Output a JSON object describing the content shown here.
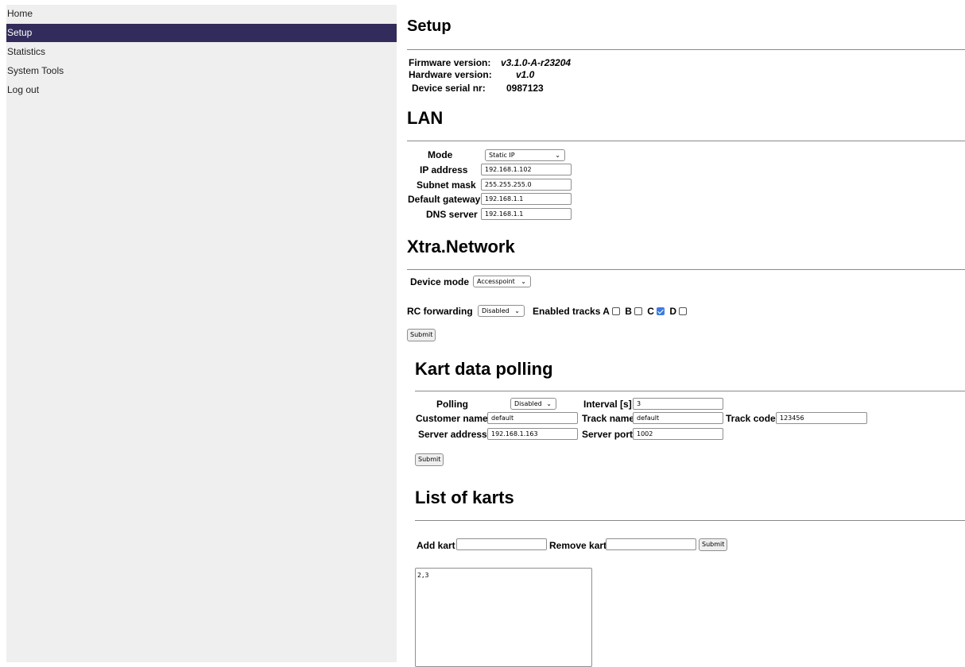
{
  "sidebar": {
    "items": [
      {
        "label": "Home"
      },
      {
        "label": "Setup",
        "active": true
      },
      {
        "label": "Statistics"
      },
      {
        "label": "System Tools"
      },
      {
        "label": "Log out"
      }
    ]
  },
  "setup": {
    "title": "Setup",
    "firmware_label": "Firmware version:",
    "firmware_value": "v3.1.0-A-r23204",
    "hardware_label": "Hardware version:",
    "hardware_value": "v1.0",
    "serial_label": "Device serial nr:",
    "serial_value": "0987123"
  },
  "lan": {
    "title": "LAN",
    "mode_label": "Mode",
    "mode_value": "Static IP",
    "ip_label": "IP address",
    "ip_value": "192.168.1.102",
    "subnet_label": "Subnet mask",
    "subnet_value": "255.255.255.0",
    "gateway_label": "Default gateway",
    "gateway_value": "192.168.1.1",
    "dns_label": "DNS server",
    "dns_value": "192.168.1.1"
  },
  "xtra": {
    "title": "Xtra.Network",
    "device_mode_label": "Device mode",
    "device_mode_value": "Accesspoint",
    "rc_label": "RC forwarding",
    "rc_value": "Disabled",
    "tracks_label": "Enabled tracks",
    "tracks": [
      {
        "label": "A",
        "checked": false
      },
      {
        "label": "B",
        "checked": false
      },
      {
        "label": "C",
        "checked": true
      },
      {
        "label": "D",
        "checked": false
      }
    ],
    "submit_label": "Submit"
  },
  "kart": {
    "title": "Kart data polling",
    "polling_label": "Polling",
    "polling_value": "Disabled",
    "interval_label": "Interval [s]",
    "interval_value": "3",
    "customer_label": "Customer name",
    "customer_value": "default",
    "track_name_label": "Track name",
    "track_name_value": "default",
    "track_code_label": "Track code",
    "track_code_value": "123456",
    "server_address_label": "Server address",
    "server_address_value": "192.168.1.163",
    "server_port_label": "Server port",
    "server_port_value": "1002",
    "submit_label": "Submit"
  },
  "karts": {
    "title": "List of karts",
    "add_label": "Add kart",
    "add_value": "",
    "remove_label": "Remove kart",
    "remove_value": "",
    "submit_label": "Submit",
    "list_value": "2,3"
  }
}
